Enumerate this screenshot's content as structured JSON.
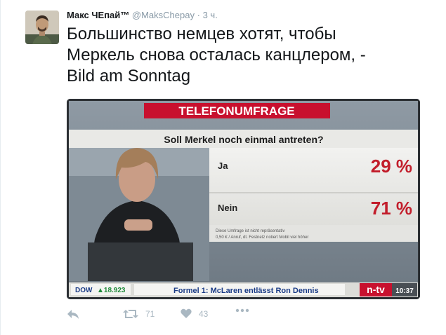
{
  "tweet": {
    "display_name": "Макс ЧЕпай™",
    "handle": "@MaksChepay",
    "separator": "·",
    "time": "3 ч.",
    "text_line1": "Большинство немцев хотят, чтобы",
    "text_line2": "Меркель снова осталась канцлером, -",
    "text_line3": "Bild am Sonntag"
  },
  "media": {
    "banner": "TELEFONUMFRAGE",
    "question": "Soll Merkel noch einmal antreten?",
    "options": [
      {
        "label": "Ja",
        "value": "29 %"
      },
      {
        "label": "Nein",
        "value": "71 %"
      }
    ],
    "footnote_line1": "Diese Umfrage ist nicht repräsentativ",
    "footnote_line2": "0,50 € / Anruf, dt. Festnetz notiert Mobil viel höher",
    "ticker_index": "DOW",
    "ticker_value": "▲18.923",
    "ticker_news": "Formel 1: McLaren entlässt Ron Dennis",
    "channel": "n-tv",
    "clock": "10:37"
  },
  "actions": {
    "retweet_count": "71",
    "like_count": "43"
  },
  "colors": {
    "name": "#14171a",
    "secondary": "#8899a6",
    "icon": "#aab8c2",
    "banner_red": "#c8102e",
    "percent_red": "#c21d2b"
  }
}
